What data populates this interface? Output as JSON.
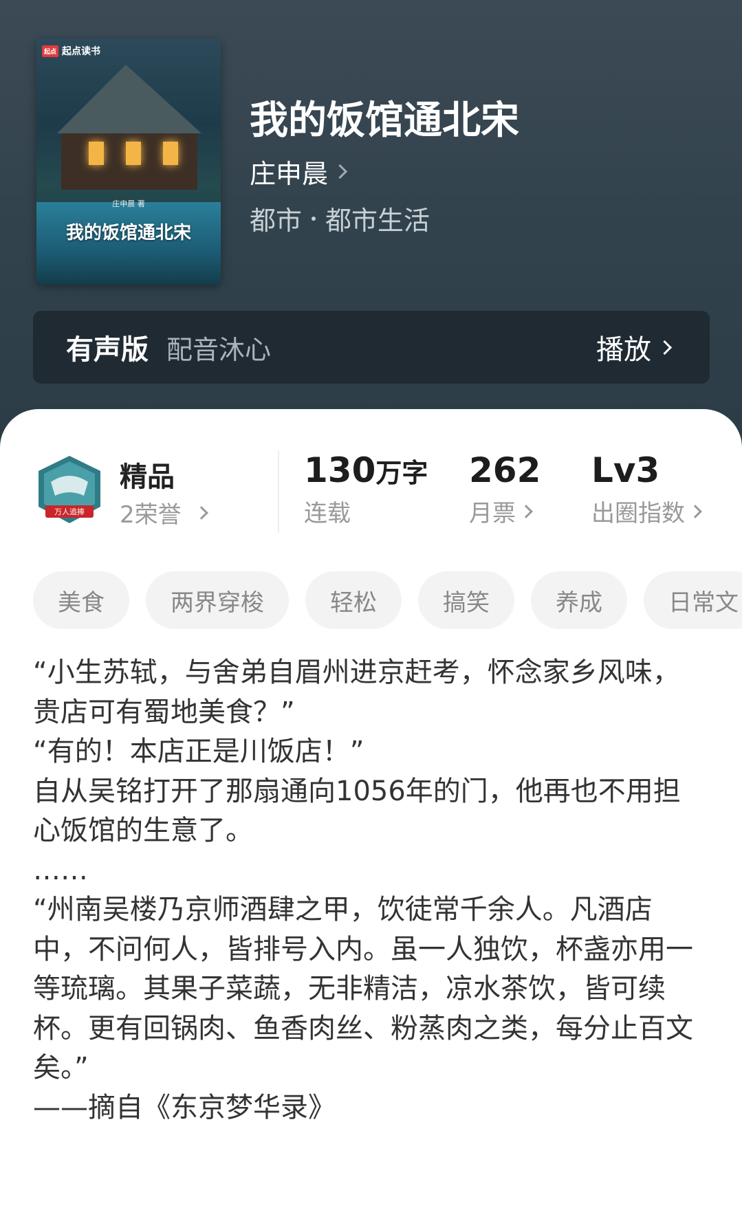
{
  "book": {
    "title": "我的饭馆通北宋",
    "author": "庄申晨",
    "category": "都市",
    "subcategory": "都市生活"
  },
  "cover": {
    "publisher": "起点读书",
    "publisher_logo": "起点",
    "author_line": "庄申晨 著",
    "title": "我的饭馆通北宋"
  },
  "audio": {
    "label": "有声版",
    "voice": "配音沐心",
    "play_label": "播放"
  },
  "honor": {
    "badge_text": "万人追捧",
    "title": "精品",
    "subtitle": "2荣誉"
  },
  "stats": [
    {
      "value": "130",
      "unit": "万字",
      "label": "连载"
    },
    {
      "value": "262",
      "unit": "",
      "label": "月票"
    },
    {
      "value": "Lv3",
      "unit": "",
      "label": "出圈指数"
    }
  ],
  "tags": [
    "美食",
    "两界穿梭",
    "轻松",
    "搞笑",
    "养成",
    "日常文"
  ],
  "intro": [
    "“小生苏轼，与舍弟自眉州进京赶考，怀念家乡风味，贵店可有蜀地美食？”",
    "“有的！本店正是川饭店！”",
    "自从吴铭打开了那扇通向1056年的门，他再也不用担心饭馆的生意了。",
    "……",
    "“州南吴楼乃京师酒肆之甲，饮徒常千余人。凡酒店中，不问何人，皆排号入内。虽一人独饮，杯盏亦用一等琉璃。其果子菜蔬，无非精洁，凉水茶饮，皆可续杯。更有回锅肉、鱼香肉丝、粉蒸肉之类，每分止百文矣。”",
    "——摘自《东京梦华录》"
  ],
  "colors": {
    "hero_bg": "#33434d",
    "audio_bar_bg": "#1f2a33",
    "tag_bg": "#f3f3f3",
    "badge_red": "#c8262b",
    "badge_teal": "#2f7c86"
  }
}
